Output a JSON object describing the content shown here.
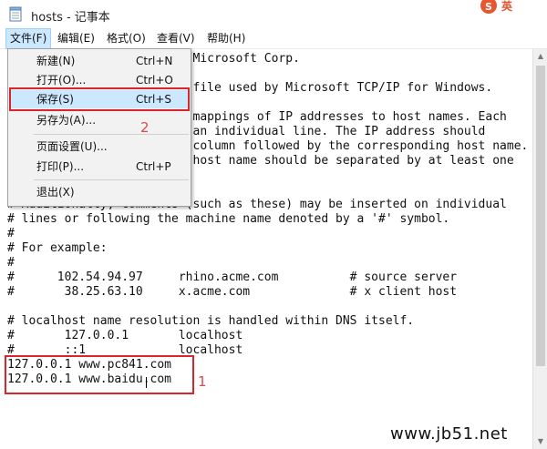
{
  "window": {
    "title": "hosts - 记事本",
    "logo_text": "英"
  },
  "menubar": [
    "文件(F)",
    "编辑(E)",
    "格式(O)",
    "查看(V)",
    "帮助(H)"
  ],
  "file_menu": {
    "items": [
      {
        "label": "新建(N)",
        "shortcut": "Ctrl+N"
      },
      {
        "label": "打开(O)...",
        "shortcut": "Ctrl+O"
      },
      {
        "label": "保存(S)",
        "shortcut": "Ctrl+S"
      },
      {
        "label": "另存为(A)...",
        "shortcut": ""
      },
      {
        "label": "页面设置(U)...",
        "shortcut": ""
      },
      {
        "label": "打印(P)...",
        "shortcut": "Ctrl+P"
      },
      {
        "label": "退出(X)",
        "shortcut": ""
      }
    ]
  },
  "editor": {
    "lines": [
      "                          Microsoft Corp.",
      "",
      "                          file used by Microsoft TCP/IP for Windows.",
      "",
      "                          mappings of IP addresses to host names. Each",
      "                          an individual line. The IP address should",
      "                          column followed by the corresponding host name.",
      "                          host name should be separated by at least one",
      "",
      "",
      "# Additionally, comments (such as these) may be inserted on individual",
      "# lines or following the machine name denoted by a '#' symbol.",
      "#",
      "# For example:",
      "#",
      "#      102.54.94.97     rhino.acme.com          # source server",
      "#       38.25.63.10     x.acme.com              # x client host",
      "",
      "# localhost name resolution is handled within DNS itself.",
      "#       127.0.0.1       localhost",
      "#       ::1             localhost",
      "127.0.0.1 www.pc841.com",
      "127.0.0.1 www.baidu.com"
    ]
  },
  "annotations": {
    "num1": "1",
    "num2": "2",
    "color": "#d9252b"
  },
  "watermark": "www.jb51.net",
  "colors": {
    "menu_highlight": "#cce8ff",
    "menu_highlight_border": "#99d1ff",
    "menu_bg": "#f2f2f2"
  }
}
